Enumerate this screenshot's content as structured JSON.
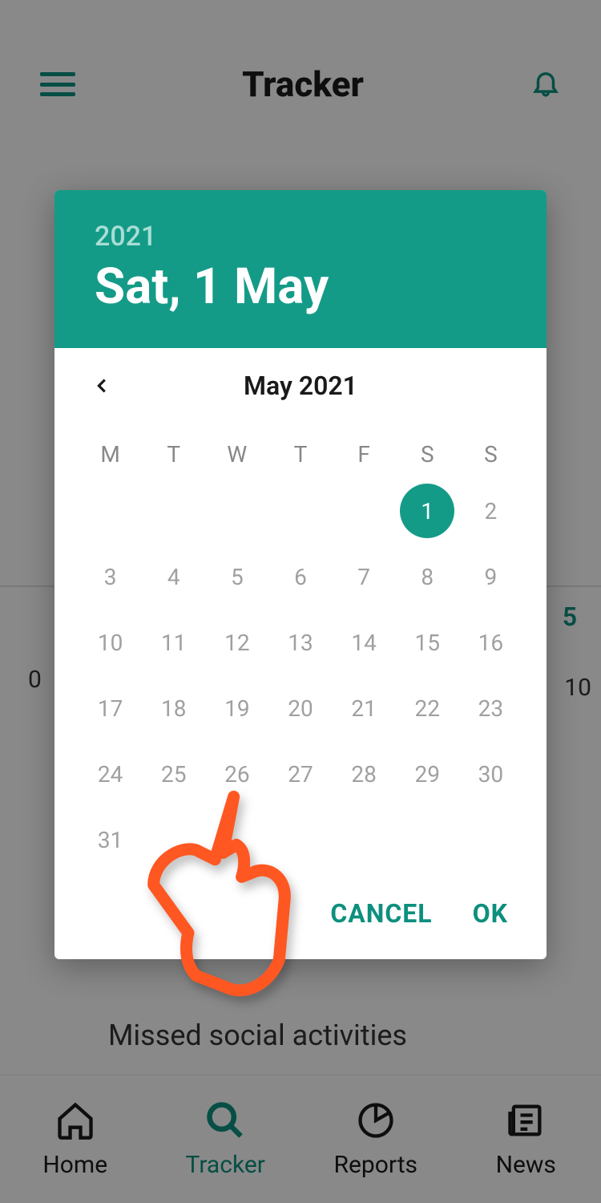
{
  "header": {
    "title": "Tracker"
  },
  "background": {
    "leftNum": "0",
    "rightTop": "5",
    "rightBottom": "10",
    "itemText": "Missed social activities"
  },
  "bottomNav": {
    "home": "Home",
    "tracker": "Tracker",
    "reports": "Reports",
    "news": "News"
  },
  "datePicker": {
    "year": "2021",
    "selectedLabel": "Sat, 1 May",
    "monthLabel": "May 2021",
    "weekdays": [
      "M",
      "T",
      "W",
      "T",
      "F",
      "S",
      "S"
    ],
    "weeks": [
      [
        "",
        "",
        "",
        "",
        "",
        "1",
        "2"
      ],
      [
        "3",
        "4",
        "5",
        "6",
        "7",
        "8",
        "9"
      ],
      [
        "10",
        "11",
        "12",
        "13",
        "14",
        "15",
        "16"
      ],
      [
        "17",
        "18",
        "19",
        "20",
        "21",
        "22",
        "23"
      ],
      [
        "24",
        "25",
        "26",
        "27",
        "28",
        "29",
        "30"
      ],
      [
        "31",
        "",
        "",
        "",
        "",
        "",
        ""
      ]
    ],
    "selectedDay": "1",
    "cancel": "CANCEL",
    "ok": "OK"
  }
}
